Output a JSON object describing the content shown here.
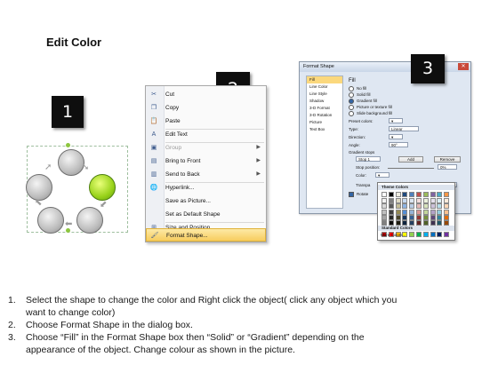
{
  "title": "Edit Color",
  "badges": [
    "1",
    "2",
    "3"
  ],
  "context_menu": {
    "items": [
      {
        "label": "Cut",
        "icon": "scissors-icon",
        "glyph": "✂",
        "enabled": true,
        "submenu": false
      },
      {
        "label": "Copy",
        "icon": "copy-icon",
        "glyph": "❐",
        "enabled": true,
        "submenu": false
      },
      {
        "label": "Paste",
        "icon": "paste-icon",
        "glyph": "📋",
        "enabled": true,
        "submenu": false
      },
      {
        "label": "Edit Text",
        "icon": "edit-text-icon",
        "glyph": "A",
        "enabled": true,
        "submenu": false
      },
      {
        "label": "Group",
        "icon": "group-icon",
        "glyph": "▣",
        "enabled": false,
        "submenu": true
      },
      {
        "label": "Bring to Front",
        "icon": "bring-to-front-icon",
        "glyph": "▤",
        "enabled": true,
        "submenu": true
      },
      {
        "label": "Send to Back",
        "icon": "send-to-back-icon",
        "glyph": "▥",
        "enabled": true,
        "submenu": true
      },
      {
        "label": "Hyperlink...",
        "icon": "hyperlink-icon",
        "glyph": "🌐",
        "enabled": true,
        "submenu": false
      },
      {
        "label": "Save as Picture...",
        "icon": "",
        "glyph": "",
        "enabled": true,
        "submenu": false
      },
      {
        "label": "Set as Default Shape",
        "icon": "",
        "glyph": "",
        "enabled": true,
        "submenu": false
      },
      {
        "label": "Size and Position...",
        "icon": "size-position-icon",
        "glyph": "⊞",
        "enabled": true,
        "submenu": false
      },
      {
        "label": "Format Shape...",
        "icon": "format-shape-icon",
        "glyph": "🖌",
        "enabled": true,
        "submenu": false,
        "highlighted": true
      }
    ]
  },
  "dialog": {
    "title": "Format Shape",
    "close": "✕",
    "nav": [
      "Fill",
      "Line Color",
      "Line Style",
      "Shadow",
      "3-D Format",
      "3-D Rotation",
      "Picture",
      "Text Box"
    ],
    "section": "Fill",
    "options": [
      "No fill",
      "Solid fill",
      "Gradient fill",
      "Picture or texture fill",
      "Slide background fill"
    ],
    "selected_option": "Gradient fill",
    "preset_label": "Preset colors:",
    "type_label": "Type:",
    "type_value": "Linear",
    "direction_label": "Direction:",
    "angle_label": "Angle:",
    "angle_value": "90°",
    "stops_label": "Gradient stops",
    "stop_value": "Stop 1",
    "add_label": "Add",
    "remove_label": "Remove",
    "stop_position_label": "Stop position:",
    "stop_position_value": "0%",
    "color_label": "Color:",
    "transparency_label": "Transpa",
    "rotate_label": "Rotate",
    "transparency_value": "0%"
  },
  "palette": {
    "theme_label": "Theme Colors",
    "standard_label": "Standard Colors",
    "more_label": "More Colors...",
    "theme_top": [
      "#ffffff",
      "#000000",
      "#eeece1",
      "#1f497d",
      "#4f81bd",
      "#c0504d",
      "#9bbb59",
      "#8064a2",
      "#4bacc6",
      "#f79646"
    ],
    "theme_shades": [
      [
        "#f2f2f2",
        "#7f7f7f",
        "#ddd9c3",
        "#c6d9f0",
        "#dbe5f1",
        "#f2dcdb",
        "#ebf1dd",
        "#e5e0ec",
        "#dbeef3",
        "#fdeada"
      ],
      [
        "#d8d8d8",
        "#595959",
        "#c4bd97",
        "#8db3e2",
        "#b8cce4",
        "#e5b9b7",
        "#d7e3bc",
        "#ccc1d9",
        "#b7dde8",
        "#fbd5b5"
      ],
      [
        "#bfbfbf",
        "#3f3f3f",
        "#938953",
        "#548dd4",
        "#95b3d7",
        "#d99694",
        "#c3d69b",
        "#b2a2c7",
        "#92cddc",
        "#fac08f"
      ],
      [
        "#a5a5a5",
        "#262626",
        "#494429",
        "#17365d",
        "#366092",
        "#953734",
        "#76923c",
        "#5f497a",
        "#31859b",
        "#e36c09"
      ],
      [
        "#7f7f7f",
        "#0c0c0c",
        "#1d1b10",
        "#0f243e",
        "#244061",
        "#632423",
        "#4f6128",
        "#3f3151",
        "#205867",
        "#974806"
      ]
    ],
    "standard": [
      "#c00000",
      "#ff0000",
      "#ffc000",
      "#ffff00",
      "#92d050",
      "#00b050",
      "#00b0f0",
      "#0070c0",
      "#002060",
      "#7030a0"
    ]
  },
  "instructions": [
    {
      "num": "1.",
      "text": "Select the shape to change the color and Right click the object( click any object which you"
    },
    {
      "num": "",
      "text": "want to change color)"
    },
    {
      "num": "2.",
      "text": "Choose Format Shape in the dialog box."
    },
    {
      "num": "3.",
      "text": "Choose “Fill” in the Format Shape box then “Solid” or “Gradient” depending on the"
    },
    {
      "num": "",
      "text": "appearance of the object. Change colour as shown in the picture."
    }
  ]
}
